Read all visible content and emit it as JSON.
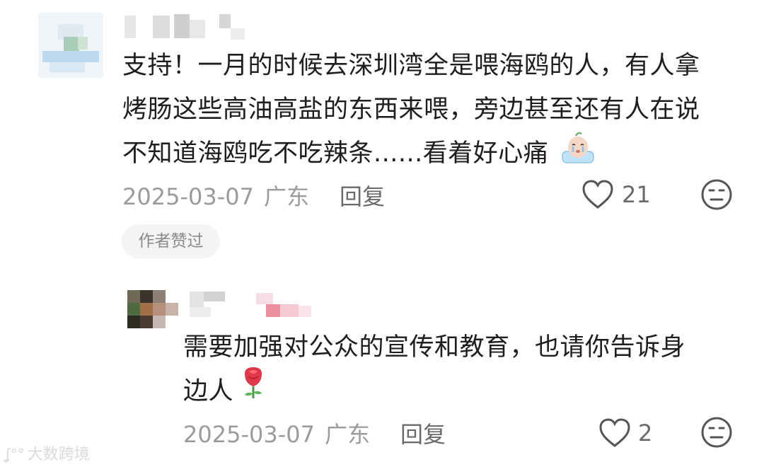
{
  "comments": [
    {
      "text_lines": [
        "支持！一月的时候去深圳湾全是喂海鸥的人，有人拿",
        "烤肠这些高油高盐的东西来喂，旁边甚至还有人在说",
        "不知道海鸥吃不吃辣条......看着好心痛"
      ],
      "date": "2025-03-07",
      "location": "广东",
      "reply_label": "回复",
      "likes": "21",
      "badge": "作者赞过",
      "emoji": "crying-face-sticker"
    },
    {
      "text_lines": [
        "需要加强对公众的宣传和教育，也请你告诉身",
        "边人"
      ],
      "date": "2025-03-07",
      "location": "广东",
      "reply_label": "回复",
      "likes": "2",
      "emoji": "rose-sticker"
    }
  ],
  "watermark": "大数跨境",
  "colors": {
    "accent_text": "#1e1e1e",
    "meta": "#9b9b9b",
    "badge_bg": "#f4f4f4"
  }
}
